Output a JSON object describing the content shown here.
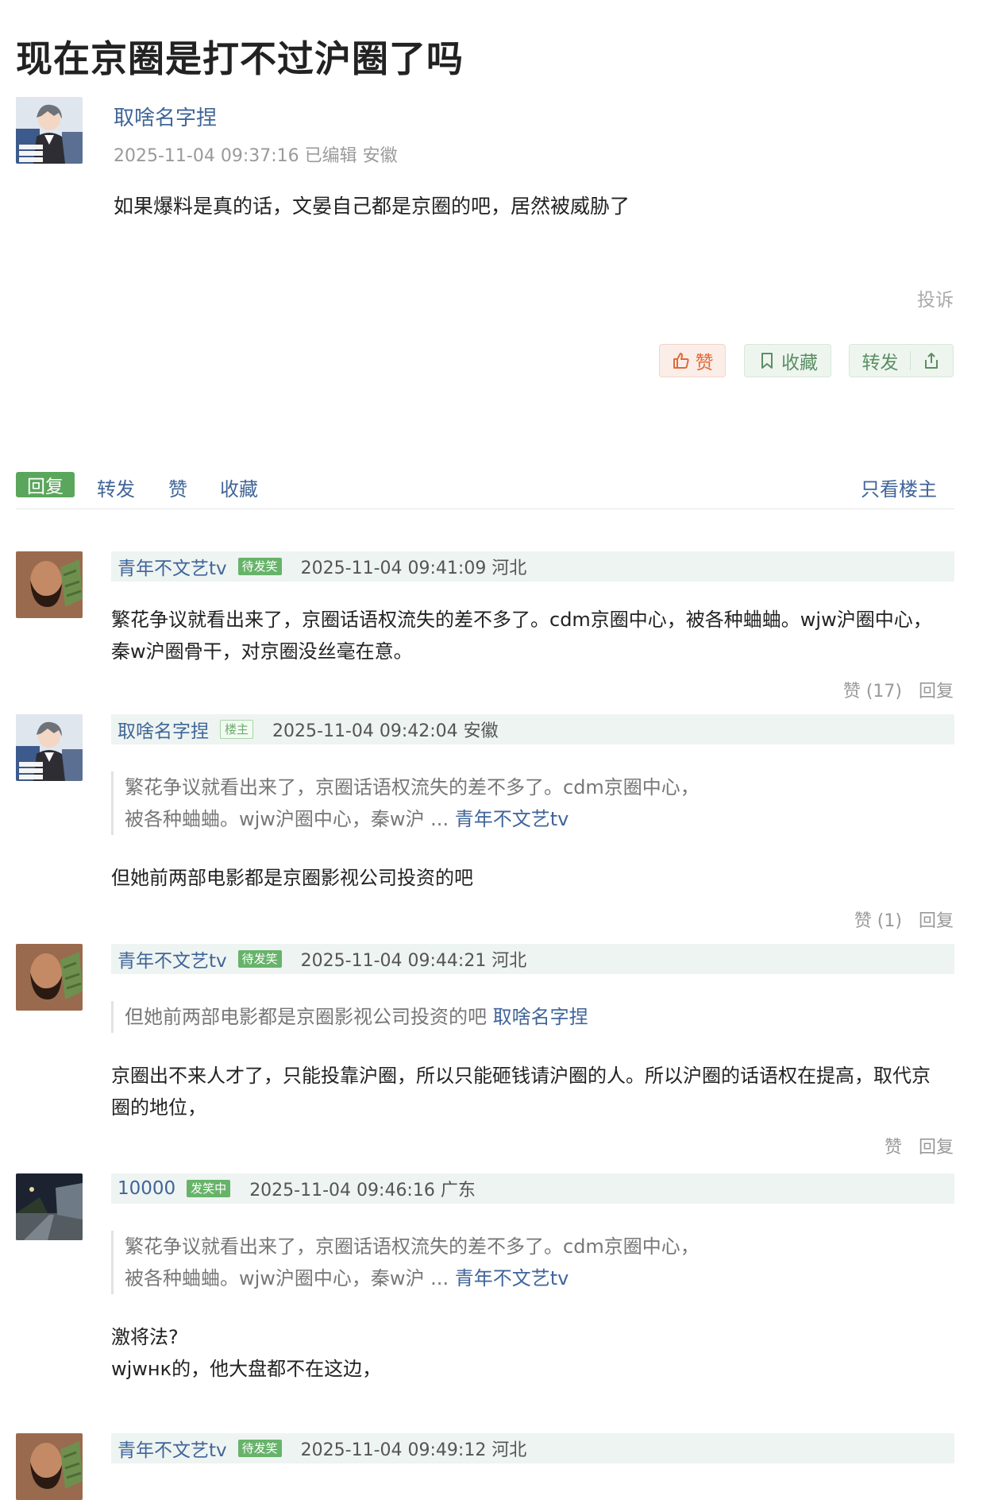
{
  "post": {
    "title": "现在京圈是打不过沪圈了吗",
    "author": "取啥名字捏",
    "meta": "2025-11-04 09:37:16 已编辑 安徽",
    "content": "如果爆料是真的话，文晏自己都是京圈的吧，居然被威胁了",
    "report": "投诉",
    "like_label": "赞",
    "favorite_label": "收藏",
    "share_label": "转发"
  },
  "toolbar": {
    "reply": "回复",
    "forward": "转发",
    "like": "赞",
    "favorite": "收藏",
    "op_only": "只看楼主"
  },
  "replies": [
    {
      "user": "青年不文艺tv",
      "badge": "待发笑",
      "time": "2025-11-04 09:41:09 河北",
      "text_lines": [
        "繁花争议就看出来了，京圈话语权流失的差不多了。cdm京圈中心，被各种蛐蛐。wjw沪圈中心，",
        "秦w沪圈骨干，对京圈没丝毫在意。"
      ],
      "likes": "赞 (17)",
      "reply": "回复"
    },
    {
      "user": "取啥名字捏",
      "badge": "楼主",
      "time": "2025-11-04 09:42:04 安徽",
      "quote_lines": [
        "繁花争议就看出来了，京圈话语权流失的差不多了。cdm京圈中心，",
        "被各种蛐蛐。wjw沪圈中心，秦w沪 ... "
      ],
      "quote_author": "青年不文艺tv",
      "text_lines": [
        "但她前两部电影都是京圈影视公司投资的吧"
      ],
      "likes": "赞 (1)",
      "reply": "回复"
    },
    {
      "user": "青年不文艺tv",
      "badge": "待发笑",
      "time": "2025-11-04 09:44:21 河北",
      "quote_lines": [
        "但她前两部电影都是京圈影视公司投资的吧 "
      ],
      "quote_author": "取啥名字捏",
      "text_lines": [
        "京圈出不来人才了，只能投靠沪圈，所以只能砸钱请沪圈的人。所以沪圈的话语权在提高，取代京",
        "圈的地位，"
      ],
      "likes": "赞",
      "reply": "回复"
    },
    {
      "user": "10000",
      "badge": "发笑中",
      "time": "2025-11-04 09:46:16 广东",
      "quote_lines": [
        "繁花争议就看出来了，京圈话语权流失的差不多了。cdm京圈中心，",
        "被各种蛐蛐。wjw沪圈中心，秦w沪 ... "
      ],
      "quote_author": "青年不文艺tv",
      "text_lines": [
        "激将法?",
        "wjwнк的，他大盘都不在这边，"
      ]
    },
    {
      "user": "青年不文艺tv",
      "badge": "待发笑",
      "time": "2025-11-04 09:49:12 河北"
    }
  ]
}
